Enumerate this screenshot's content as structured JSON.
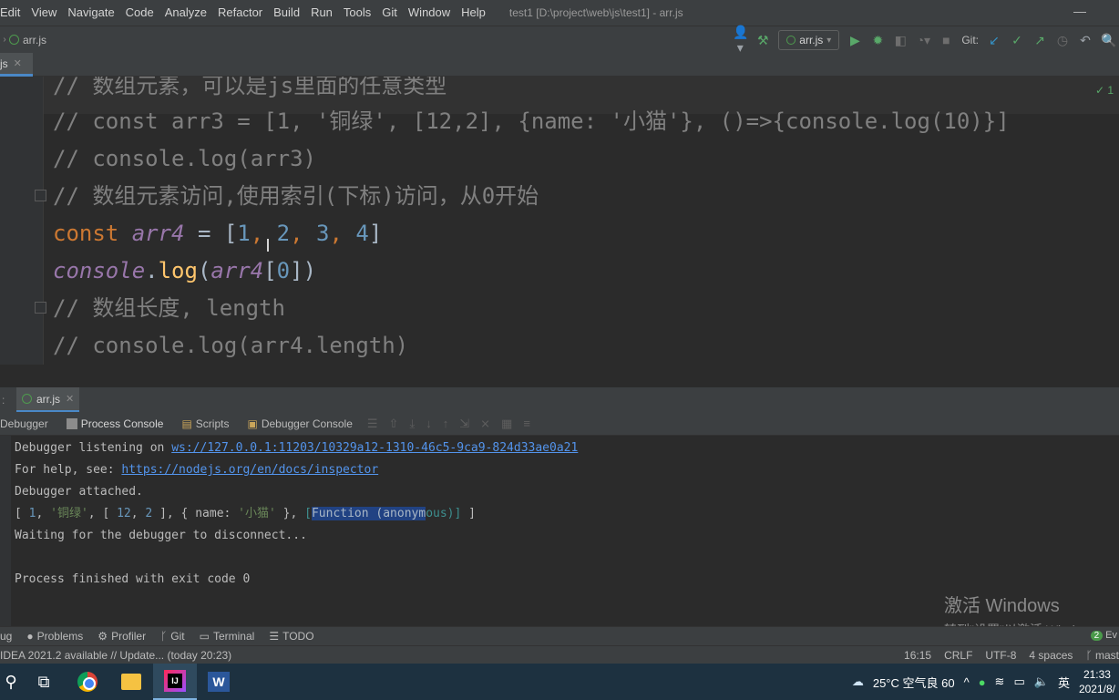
{
  "menu": [
    "Edit",
    "View",
    "Navigate",
    "Code",
    "Analyze",
    "Refactor",
    "Build",
    "Run",
    "Tools",
    "Git",
    "Window",
    "Help"
  ],
  "window_title": "test1 [D:\\project\\web\\js\\test1] - arr.js",
  "breadcrumb": "arr.js",
  "run_config": "arr.js",
  "git_label": "Git:",
  "editor_tab": "js",
  "editor_gutter_mark": "✓ 1",
  "code": {
    "l1": "// 数组元素，可以是js里面的任意类型",
    "l2": "// const arr3 = [1, '铜绿', [12,2], {name: '小猫'}, ()=>{console.log(10)}]",
    "l3": "// console.log(arr3)",
    "l4": "// 数组元素访问,使用索引(下标)访问，从0开始",
    "l5_kw": "const ",
    "l5_var": "arr4",
    "l5_eq": " = [",
    "l5_n1": "1",
    "l5_c1": ", ",
    "l5_n2": "2",
    "l5_c2": ", ",
    "l5_n3": "3",
    "l5_c3": ", ",
    "l5_n4": "4",
    "l5_end": "]",
    "l6_obj": "console",
    "l6_dot": ".",
    "l6_fn": "log",
    "l6_p1": "(",
    "l6_var": "arr4",
    "l6_br1": "[",
    "l6_idx": "0",
    "l6_br2": "])",
    "l7": "// 数组长度, length",
    "l8": "// console.log(arr4.length)"
  },
  "run_tab": "arr.js",
  "tool_tabs": [
    "Debugger",
    "Process Console",
    "Scripts",
    "Debugger Console"
  ],
  "console": {
    "l1_text": "Debugger listening on ",
    "l1_link": "ws://127.0.0.1:11203/10329a12-1310-46c5-9ca9-824d33ae0a21",
    "l2_text": "For help, see: ",
    "l2_link": "https://nodejs.org/en/docs/inspector",
    "l3": "Debugger attached.",
    "l4_a": "[ ",
    "l4_n1": "1",
    "l4_b": ", ",
    "l4_s1": "'铜绿'",
    "l4_c": ", [ ",
    "l4_n2": "12",
    "l4_d": ", ",
    "l4_n3": "2",
    "l4_e": " ], { name: ",
    "l4_s2": "'小猫'",
    "l4_f": " }, ",
    "l4_br": "[",
    "l4_sel": "Function (anonym",
    "l4_fn_tail": "ous)]",
    "l4_g": " ]",
    "l5": "Waiting for the debugger to disconnect...",
    "l6": "Process finished with exit code 0"
  },
  "watermark": {
    "line1": "激活 Windows",
    "line2": "转到\"设置\"以激活 Windows。"
  },
  "toolstrip": [
    "ug",
    "Problems",
    "Profiler",
    "Git",
    "Terminal",
    "TODO"
  ],
  "event_badge": {
    "count": "2",
    "label": "Ev"
  },
  "status": {
    "left": "IDEA 2021.2 available // Update... (today 20:23)",
    "position": "16:15",
    "line_sep": "CRLF",
    "encoding": "UTF-8",
    "indent": "4 spaces",
    "branch": "mast"
  },
  "taskbar": {
    "weather": "25°C  空气良 60",
    "ime": "英",
    "time": "21:33",
    "date": "2021/8/"
  },
  "colors": {
    "bg": "#2b2b2b",
    "panel": "#3c3f41",
    "keyword": "#cc7832",
    "number": "#6897bb",
    "comment": "#808080",
    "link": "#5394ec",
    "selection": "#214283"
  }
}
